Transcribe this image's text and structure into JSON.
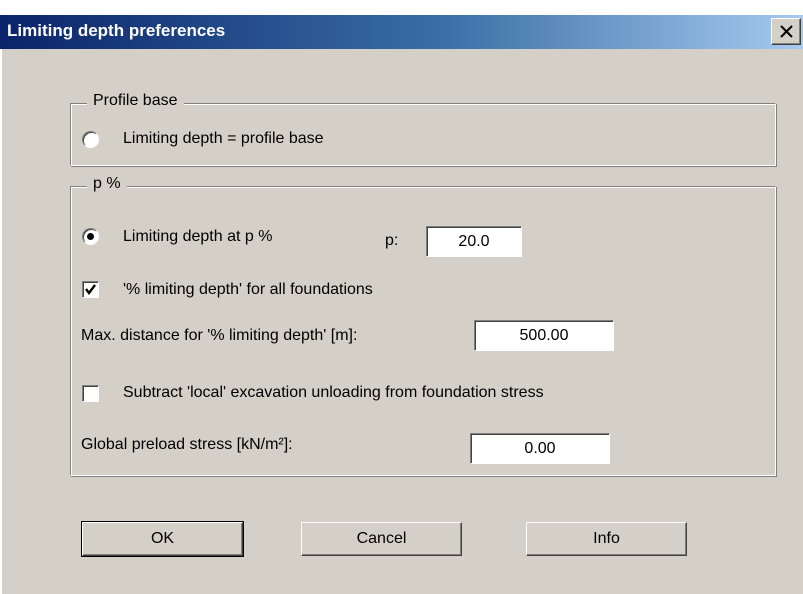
{
  "window": {
    "title": "Limiting depth preferences",
    "close_glyph": "×"
  },
  "profile_base": {
    "legend": "Profile base",
    "radio_label": "Limiting depth = profile base",
    "radio_selected": false
  },
  "p_percent": {
    "legend": "p %",
    "radio_label": "Limiting depth at p %",
    "radio_selected": true,
    "p_label": "p:",
    "p_value": "20.0",
    "all_foundations_label": "'% limiting depth' for all foundations",
    "all_foundations_checked": true,
    "max_distance_label": "Max. distance for '% limiting depth' [m]:",
    "max_distance_value": "500.00",
    "subtract_label": "Subtract 'local' excavation unloading from foundation stress",
    "subtract_checked": false,
    "preload_label": "Global preload stress [kN/m²]:",
    "preload_value": "0.00"
  },
  "buttons": {
    "ok": "OK",
    "cancel": "Cancel",
    "info": "Info"
  }
}
